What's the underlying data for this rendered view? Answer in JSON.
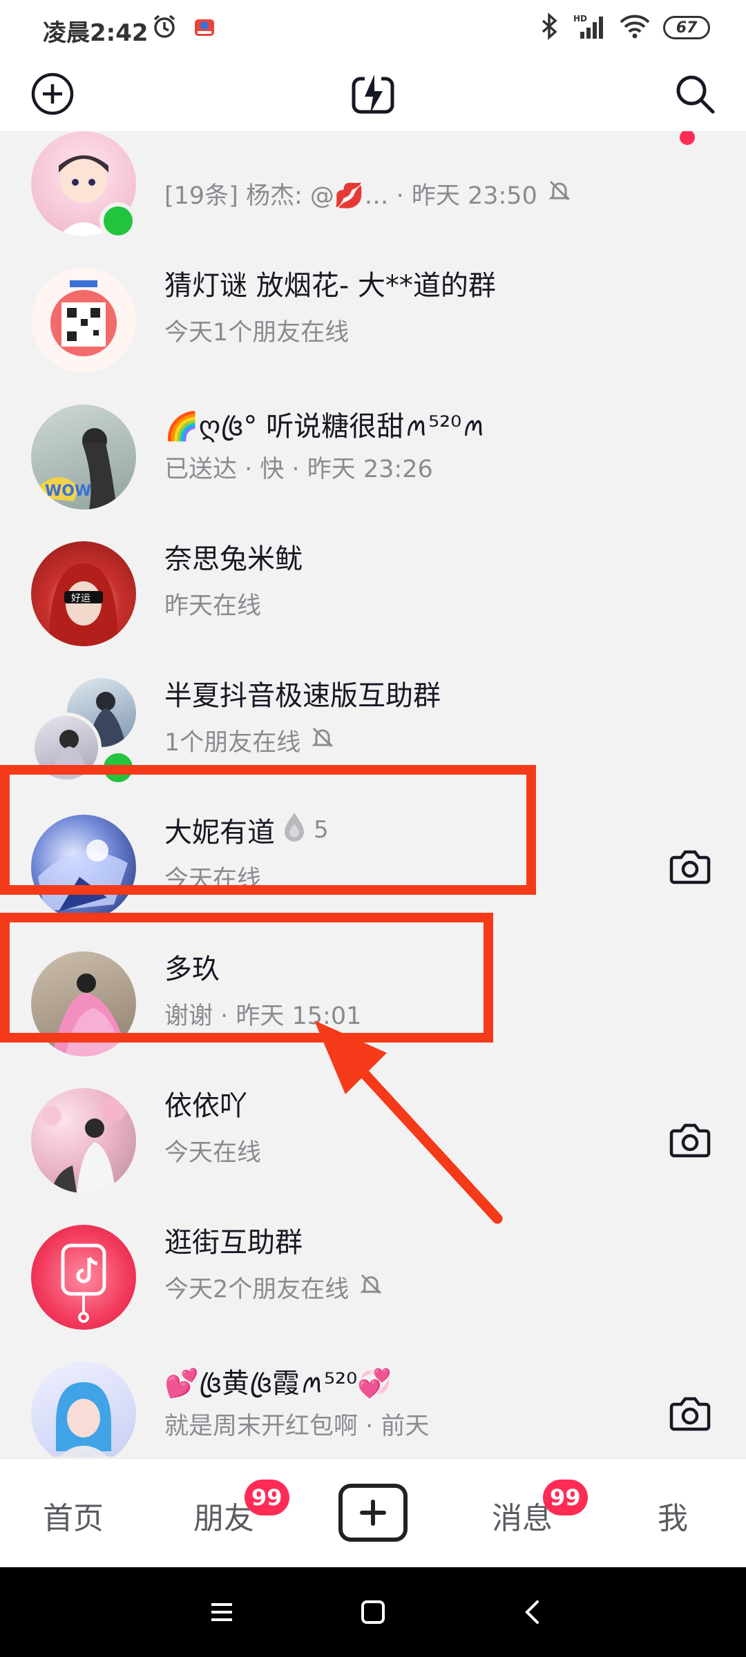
{
  "status_bar": {
    "time": "凌晨2:42",
    "battery": "67",
    "icons": [
      "alarm-icon",
      "app-notification-icon",
      "bluetooth-icon",
      "hd-signal-icon",
      "wifi-icon"
    ]
  },
  "header": {
    "icons": [
      "add-circle-icon",
      "lightning-icon",
      "search-icon"
    ]
  },
  "conversations": [
    {
      "name": "",
      "subtitle": "[19条] 杨杰: @💋… · 昨天 23:50",
      "online": true,
      "muted": true,
      "unread_dot": true
    },
    {
      "name": "猜灯谜 放烟花- 大**道的群",
      "subtitle": "今天1个朋友在线"
    },
    {
      "name": "🌈ღ꧔ꦿ° 听说糖很甜ꪔ⁵²⁰ꪔ",
      "subtitle": "已送达 · 快 · 昨天 23:26"
    },
    {
      "name": "奈思兔米鱿",
      "subtitle": "昨天在线"
    },
    {
      "name": "半夏抖音极速版互助群",
      "subtitle": "1个朋友在线",
      "online": true,
      "muted": true
    },
    {
      "name": "大妮有道",
      "spark_count": "5",
      "subtitle": "今天在线",
      "camera": true
    },
    {
      "name": "多玖",
      "subtitle": "谢谢 · 昨天 15:01"
    },
    {
      "name": "依依吖",
      "subtitle": "今天在线",
      "camera": true
    },
    {
      "name": "逛街互助群",
      "subtitle": "今天2个朋友在线",
      "muted": true
    },
    {
      "name": "💕꧔ꦿ黄꧔ꦿ霞ꪔ⁵²⁰💞",
      "subtitle": "就是周末开红包啊 · 前天",
      "camera": true
    }
  ],
  "tabs": {
    "home": "首页",
    "friends": "朋友",
    "friends_badge": "99",
    "messages": "消息",
    "messages_badge": "99",
    "me": "我"
  },
  "colors": {
    "accent": "#fe2c55",
    "online": "#22c33d",
    "annotation": "#f53a1a"
  }
}
